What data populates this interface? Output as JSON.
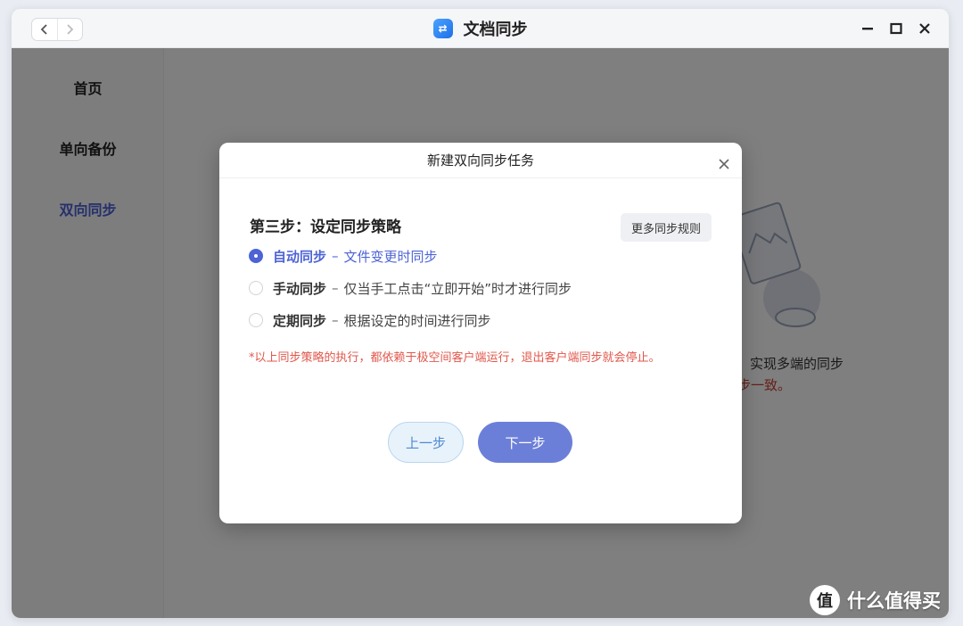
{
  "window": {
    "title": "文档同步",
    "app_icon": "sync-app-icon"
  },
  "sidebar": {
    "items": [
      {
        "label": "首页",
        "active": false
      },
      {
        "label": "单向备份",
        "active": false
      },
      {
        "label": "双向同步",
        "active": true
      }
    ]
  },
  "background": {
    "caption_line1": "实现多端的同步",
    "caption_line2": "步一致。"
  },
  "dialog": {
    "title": "新建双向同步任务",
    "step_title": "第三步：设定同步策略",
    "more_rules_label": "更多同步规则",
    "options": [
      {
        "name": "自动同步",
        "sep": "–",
        "desc": "文件变更时同步",
        "checked": true
      },
      {
        "name": "手动同步",
        "sep": "–",
        "desc": "仅当手工点击“立即开始”时才进行同步",
        "checked": false
      },
      {
        "name": "定期同步",
        "sep": "–",
        "desc": "根据设定的时间进行同步",
        "checked": false
      }
    ],
    "note": "*以上同步策略的执行，都依赖于极空间客户端运行，退出客户端同步就会停止。",
    "prev_label": "上一步",
    "next_label": "下一步"
  },
  "watermark": {
    "logo_char": "值",
    "text": "什么值得买"
  },
  "colors": {
    "accent": "#4d63d6",
    "note_red": "#e0574b",
    "next_button": "#6c7fd8"
  }
}
